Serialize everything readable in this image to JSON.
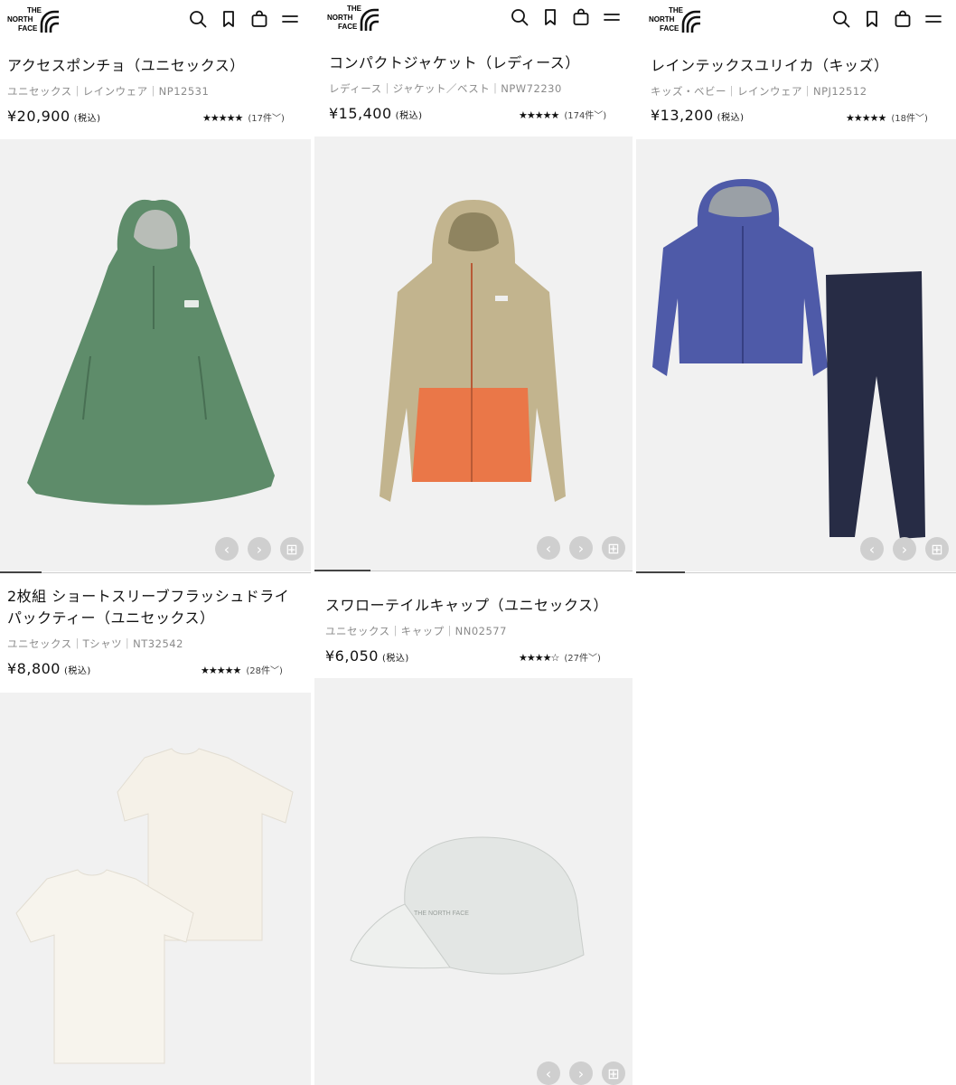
{
  "brand": {
    "line1": "THE",
    "line2": "NORTH",
    "line3": "FACE"
  },
  "header_icons": [
    "search-icon",
    "bookmark-icon",
    "shopping-bag-icon",
    "menu-icon"
  ],
  "carousel_icons": [
    "chevron-left-icon",
    "chevron-right-icon",
    "grid-icon"
  ],
  "colors": {
    "photo_bg": "#f1f1f1",
    "control_bg": "#cfcfcf",
    "text_meta": "#8a8a8a"
  },
  "products": [
    {
      "name": "アクセスポンチョ（ユニセックス）",
      "meta": "ユニセックス｜レインウェア｜NP12531",
      "price": "¥20,900",
      "tax": "(税込)",
      "stars": "★★★★★",
      "rating": 4.5,
      "reviews": "(17件﹀)",
      "image": "green rain poncho"
    },
    {
      "name": "コンパクトジャケット（レディース）",
      "meta": "レディース｜ジャケット／ベスト｜NPW72230",
      "price": "¥15,400",
      "tax": "(税込)",
      "stars": "★★★★★",
      "rating": 4.5,
      "reviews": "(174件﹀)",
      "image": "beige and orange hooded jacket"
    },
    {
      "name": "レインテックスユリイカ（キッズ）",
      "meta": "キッズ・ベビー｜レインウェア｜NPJ12512",
      "price": "¥13,200",
      "tax": "(税込)",
      "stars": "★★★★★",
      "rating": 5,
      "reviews": "(18件﹀)",
      "image": "blue rain jacket and navy rain pants"
    },
    {
      "name_line1": "2枚組 ショートスリーブフラッシュドライ",
      "name_line2": "パックティー（ユニセックス）",
      "meta": "ユニセックス｜Tシャツ｜NT32542",
      "price": "¥8,800",
      "tax": "(税込)",
      "stars": "★★★★★",
      "rating": 4.5,
      "reviews": "(28件﹀)",
      "image": "two white t-shirts"
    },
    {
      "name": "スワローテイルキャップ（ユニセックス）",
      "meta": "ユニセックス｜キャップ｜NN02577",
      "price": "¥6,050",
      "tax": "(税込)",
      "stars": "★★★★☆",
      "rating": 4,
      "reviews": "(27件﹀)",
      "image": "light grey running cap",
      "cap_logo": "THE NORTH FACE"
    }
  ]
}
